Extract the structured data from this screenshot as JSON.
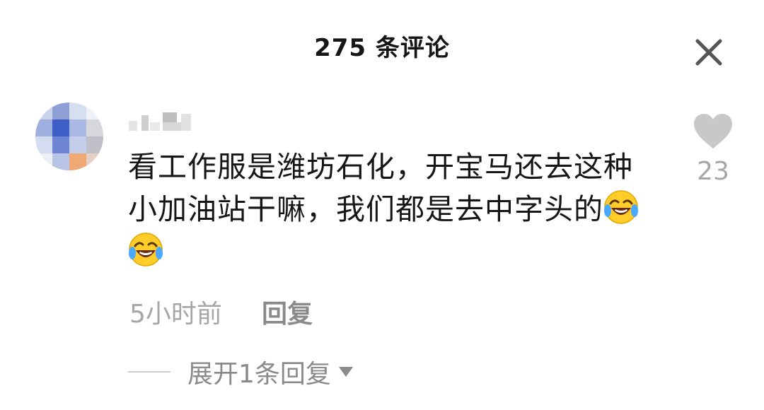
{
  "header": {
    "title": "275 条评论"
  },
  "comment": {
    "text": "看工作服是潍坊石化，开宝马还去这种小加油站干嘛，我们都是去中字头的",
    "emojis": [
      "laughing-crying-emoji",
      "laughing-crying-emoji"
    ],
    "time": "5小时前",
    "reply_label": "回复",
    "likes": "23",
    "expand_label": "展开1条回复"
  },
  "icons": {
    "close": "close-icon",
    "heart": "heart-icon",
    "caret": "caret-down-icon"
  },
  "colors": {
    "text": "#161616",
    "muted": "#a6a6a6",
    "heart": "#c8c8c8"
  }
}
